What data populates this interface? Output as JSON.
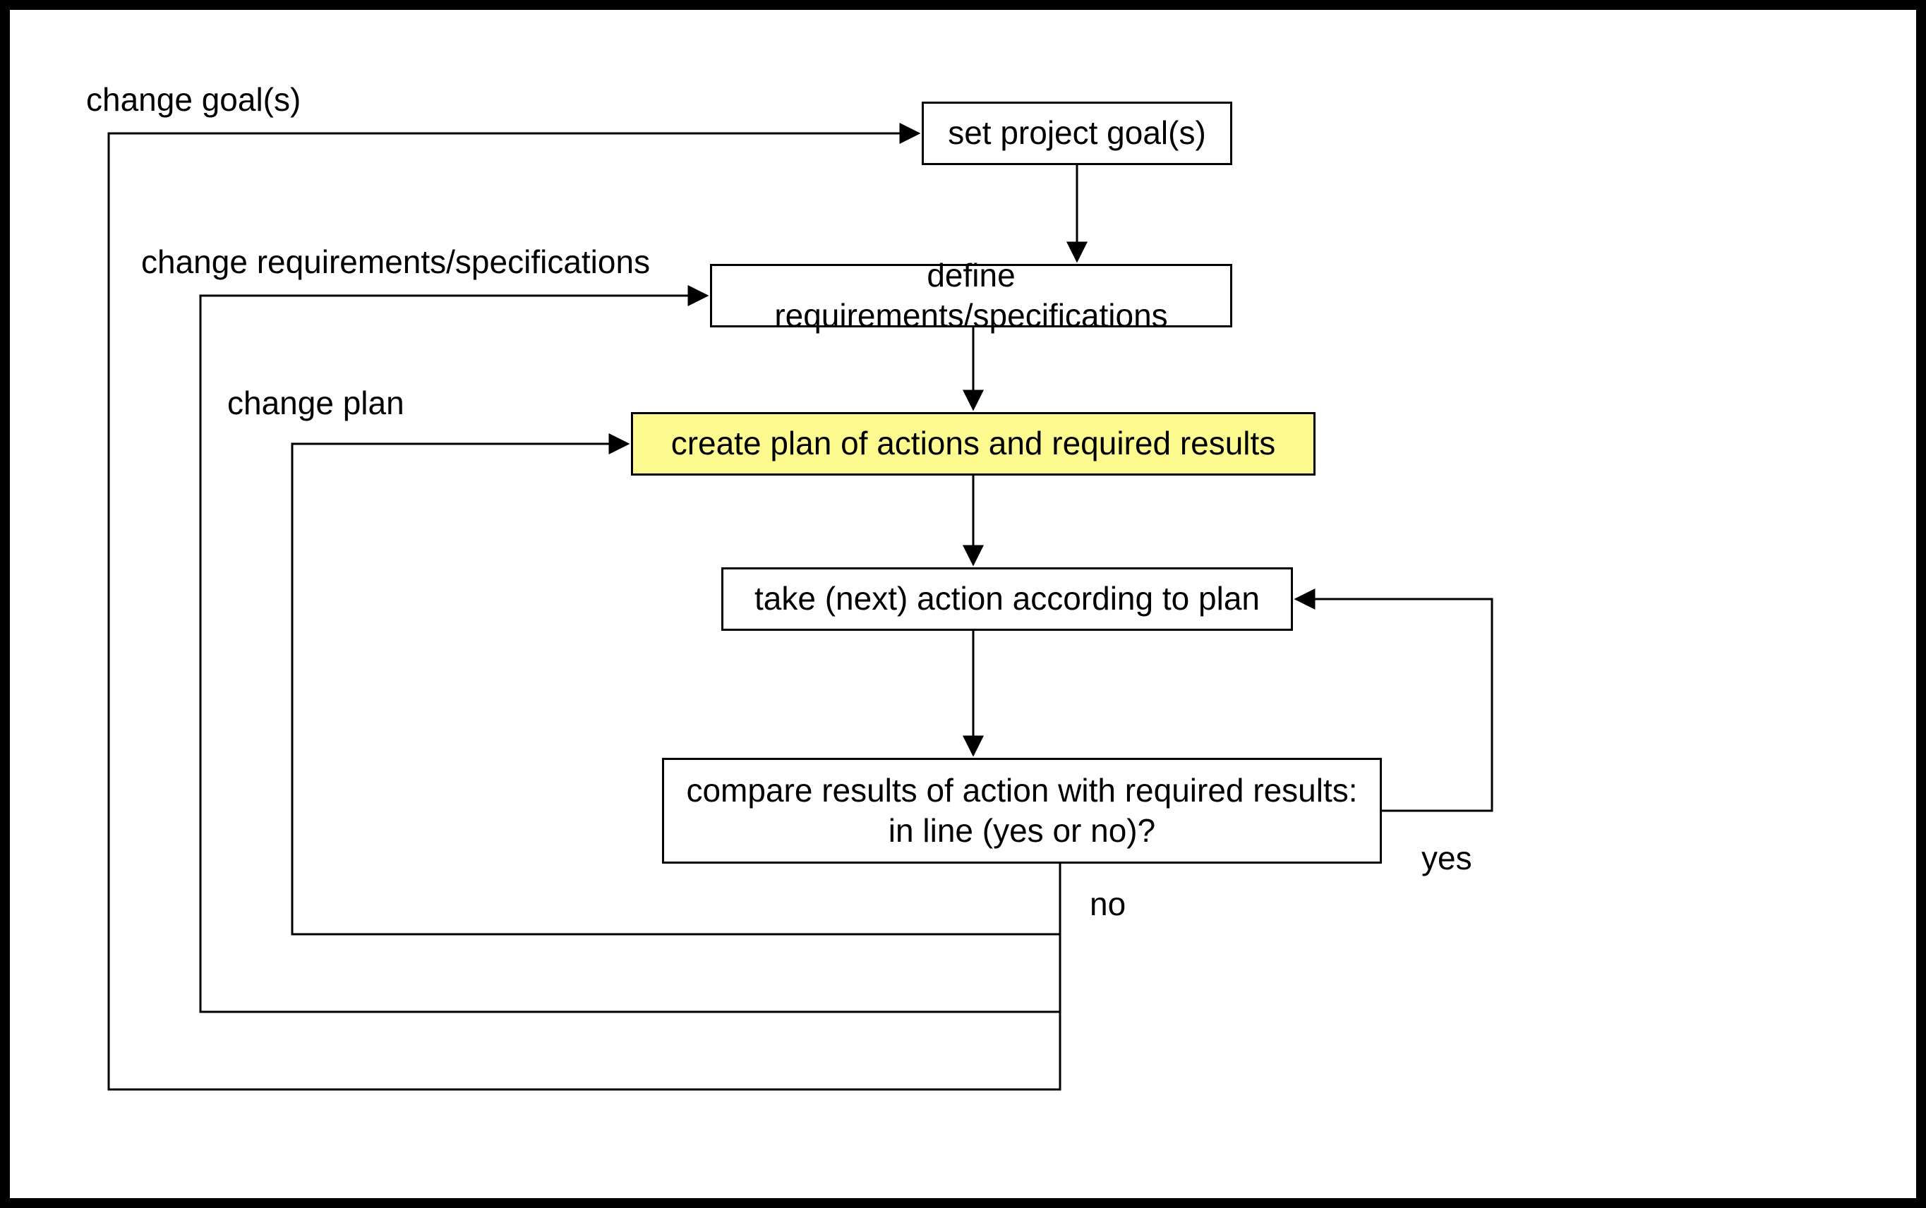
{
  "nodes": {
    "goal": "set project goal(s)",
    "req": "define requirements/specifications",
    "plan": "create plan of actions and required results",
    "act": "take (next) action according to plan",
    "cmp": "compare results of action with required results:\nin line (yes or no)?"
  },
  "labels": {
    "chgGoal": "change goal(s)",
    "chgReq": "change requirements/specifications",
    "chgPlan": "change plan",
    "yes": "yes",
    "no": "no"
  }
}
